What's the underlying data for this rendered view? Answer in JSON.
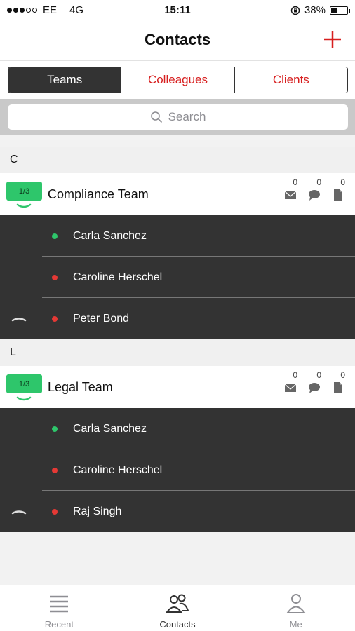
{
  "status_bar": {
    "carrier": "EE",
    "network": "4G",
    "time": "15:11",
    "battery": "38%",
    "battery_level": 0.38
  },
  "nav": {
    "title": "Contacts",
    "add_icon": "plus-icon"
  },
  "segments": [
    {
      "label": "Teams",
      "active": true
    },
    {
      "label": "Colleagues",
      "active": false
    },
    {
      "label": "Clients",
      "active": false
    }
  ],
  "search": {
    "placeholder": "Search"
  },
  "sections": [
    {
      "letter": "C",
      "team": {
        "name": "Compliance Team",
        "badge": "1/3",
        "counts": {
          "mail": "0",
          "chat": "0",
          "files": "0"
        },
        "members": [
          {
            "name": "Carla Sanchez",
            "status": "online"
          },
          {
            "name": "Caroline Herschel",
            "status": "offline"
          },
          {
            "name": "Peter Bond",
            "status": "offline"
          }
        ]
      }
    },
    {
      "letter": "L",
      "team": {
        "name": "Legal Team",
        "badge": "1/3",
        "counts": {
          "mail": "0",
          "chat": "0",
          "files": "0"
        },
        "members": [
          {
            "name": "Carla Sanchez",
            "status": "online"
          },
          {
            "name": "Caroline Herschel",
            "status": "offline"
          },
          {
            "name": "Raj Singh",
            "status": "offline"
          }
        ]
      }
    }
  ],
  "tab_bar": [
    {
      "label": "Recent",
      "icon": "list-icon",
      "active": false
    },
    {
      "label": "Contacts",
      "icon": "contacts-icon",
      "active": true
    },
    {
      "label": "Me",
      "icon": "person-icon",
      "active": false
    }
  ],
  "colors": {
    "accent": "#d71f1f",
    "online": "#2ec66b",
    "offline": "#e53935",
    "dark": "#333333"
  }
}
